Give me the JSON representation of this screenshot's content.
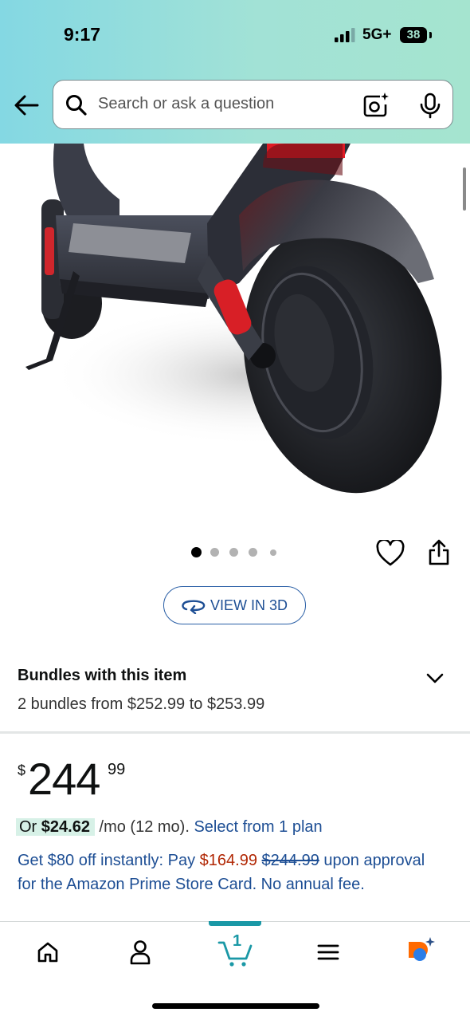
{
  "status_bar": {
    "time": "9:17",
    "network": "5G+",
    "battery": "38"
  },
  "search": {
    "placeholder": "Search or ask a question",
    "value": ""
  },
  "icons": {
    "back": "arrow-left-icon",
    "search": "magnifier-icon",
    "camera": "camera-lens-icon",
    "mic": "microphone-icon",
    "heart": "heart-icon",
    "share": "share-icon",
    "rotate": "rotate-3d-icon",
    "chevron": "chevron-down-icon"
  },
  "product_image": {
    "alt": "Electric scooter rear wheel",
    "total_images": 5,
    "active_index": 0
  },
  "view_3d": {
    "label": "VIEW IN 3D"
  },
  "bundles": {
    "title": "Bundles with this item",
    "subtitle": "2 bundles from $252.99 to $253.99"
  },
  "price": {
    "currency": "$",
    "whole": "244",
    "fraction": "99"
  },
  "monthly": {
    "prefix": "Or",
    "amount": "$24.62",
    "per": "/mo (12 mo).",
    "link": "Select from 1 plan"
  },
  "promo": {
    "text1": "Get $80 off instantly: Pay",
    "new_price": "$164.99",
    "old_price": "$244.99",
    "text2": "upon approval for the Amazon Prime Store Card. No annual fee."
  },
  "tab_bar": {
    "items": [
      {
        "name": "Home",
        "icon": "home-icon"
      },
      {
        "name": "Account",
        "icon": "user-icon"
      },
      {
        "name": "Cart",
        "icon": "cart-icon",
        "badge": "1",
        "active": true
      },
      {
        "name": "Menu",
        "icon": "menu-icon"
      },
      {
        "name": "Rufus",
        "icon": "ai-assistant-icon"
      }
    ]
  },
  "colors": {
    "link": "#1d4e94",
    "price_red": "#b12704",
    "accent": "#1a98a6",
    "assistant": "#ff6a00"
  }
}
